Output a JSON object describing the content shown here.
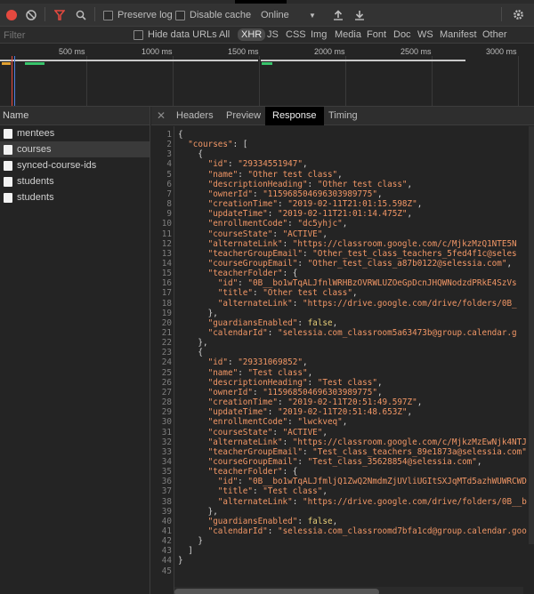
{
  "toolbar": {
    "preserve_log": "Preserve log",
    "disable_cache": "Disable cache",
    "throttle": "Online"
  },
  "filterbar": {
    "filter_placeholder": "Filter",
    "hide_data_urls": "Hide data URLs",
    "types": [
      "All",
      "XHR",
      "JS",
      "CSS",
      "Img",
      "Media",
      "Font",
      "Doc",
      "WS",
      "Manifest",
      "Other"
    ],
    "active_type": "XHR"
  },
  "overview": {
    "ticks": [
      "500 ms",
      "1000 ms",
      "1500 ms",
      "2000 ms",
      "2500 ms",
      "3000 ms"
    ]
  },
  "requests": {
    "header": "Name",
    "items": [
      "mentees",
      "courses",
      "synced-course-ids",
      "students",
      "students"
    ],
    "selected_index": 1
  },
  "detail_tabs": {
    "items": [
      "Headers",
      "Preview",
      "Response",
      "Timing"
    ],
    "active": "Response"
  },
  "response_lines": [
    "{",
    "  \"courses\": [",
    "    {",
    "      \"id\": \"29334551947\",",
    "      \"name\": \"Other test class\",",
    "      \"descriptionHeading\": \"Other test class\",",
    "      \"ownerId\": \"115968504696303989775\",",
    "      \"creationTime\": \"2019-02-11T21:01:15.598Z\",",
    "      \"updateTime\": \"2019-02-11T21:01:14.475Z\",",
    "      \"enrollmentCode\": \"dc5yhjc\",",
    "      \"courseState\": \"ACTIVE\",",
    "      \"alternateLink\": \"https://classroom.google.com/c/MjkzMzQ1NTE5N",
    "      \"teacherGroupEmail\": \"Other_test_class_teachers_5fed4f1c@seles",
    "      \"courseGroupEmail\": \"Other_test_class_a87b0122@selessia.com\",",
    "      \"teacherFolder\": {",
    "        \"id\": \"0B__bo1wTqALJfnlWRHBzOVRWLUZOeGpDcnJHQWNodzdPRkE4SzVs",
    "        \"title\": \"Other test class\",",
    "        \"alternateLink\": \"https://drive.google.com/drive/folders/0B_",
    "      },",
    "      \"guardiansEnabled\": false,",
    "      \"calendarId\": \"selessia.com_classroom5a63473b@group.calendar.g",
    "    },",
    "    {",
    "      \"id\": \"29331069852\",",
    "      \"name\": \"Test class\",",
    "      \"descriptionHeading\": \"Test class\",",
    "      \"ownerId\": \"115968504696303989775\",",
    "      \"creationTime\": \"2019-02-11T20:51:49.597Z\",",
    "      \"updateTime\": \"2019-02-11T20:51:48.653Z\",",
    "      \"enrollmentCode\": \"lwckveq\",",
    "      \"courseState\": \"ACTIVE\",",
    "      \"alternateLink\": \"https://classroom.google.com/c/MjkzMzEwNjk4NTJ",
    "      \"teacherGroupEmail\": \"Test_class_teachers_89e1873a@selessia.com\"",
    "      \"courseGroupEmail\": \"Test_class_35628854@selessia.com\",",
    "      \"teacherFolder\": {",
    "        \"id\": \"0B__bo1wTqALJfmljQ1ZwQ2NmdmZjUVliUGItSXJqMTd5azhWUWRCWD",
    "        \"title\": \"Test class\",",
    "        \"alternateLink\": \"https://drive.google.com/drive/folders/0B__b",
    "      },",
    "      \"guardiansEnabled\": false,",
    "      \"calendarId\": \"selessia.com_classroomd7bfa1cd@group.calendar.goo",
    "    }",
    "  ]",
    "}",
    ""
  ],
  "colors": {
    "record": "#e5493f",
    "filter_icon": "#e5493f",
    "string": "#f29766",
    "background": "#242424"
  },
  "icons": [
    "record-icon",
    "clear-icon",
    "filter-icon",
    "search-icon",
    "import-icon",
    "export-icon",
    "settings-gear-icon",
    "close-icon"
  ]
}
